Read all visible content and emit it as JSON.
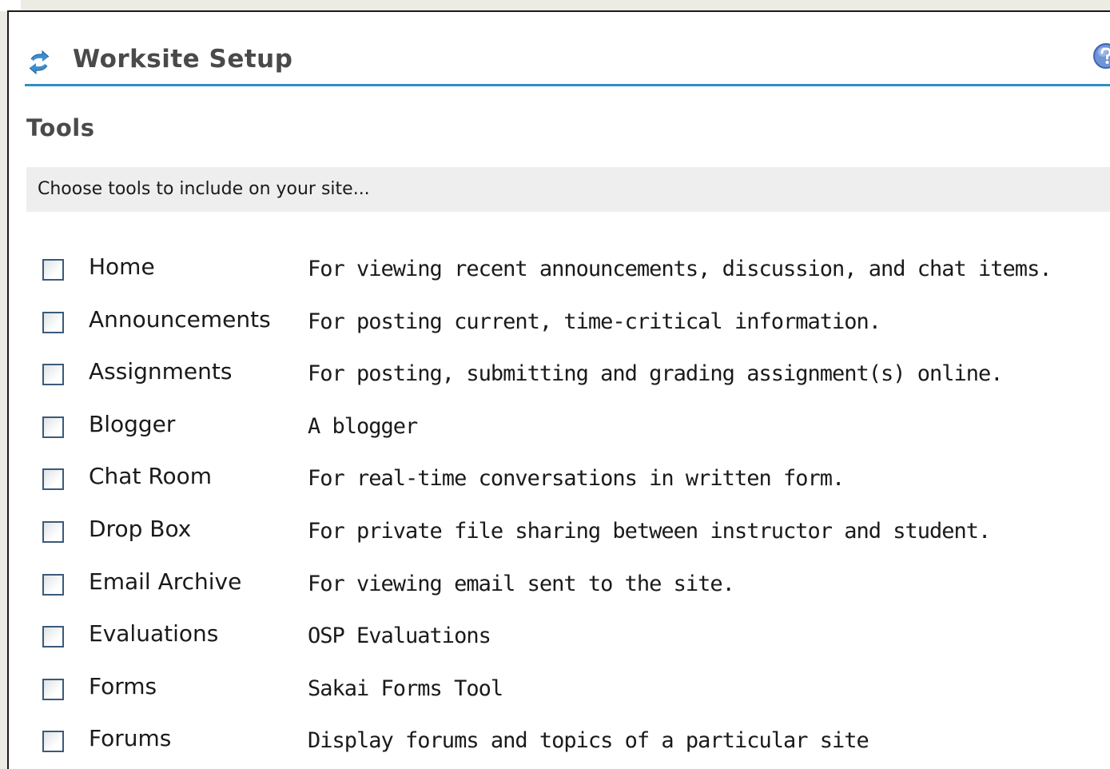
{
  "header": {
    "title": "Worksite Setup",
    "title_icon": "refresh-arrows-icon",
    "help_icon": "help-icon"
  },
  "section": {
    "title": "Tools",
    "instructions": "Choose tools to include on your site..."
  },
  "tools": [
    {
      "name": "Home",
      "description": "For viewing recent announcements, discussion, and chat items.",
      "checked": false
    },
    {
      "name": "Announcements",
      "description": "For posting current, time-critical information.",
      "checked": false
    },
    {
      "name": "Assignments",
      "description": "For posting, submitting and grading assignment(s) online.",
      "checked": false
    },
    {
      "name": "Blogger",
      "description": "A blogger",
      "checked": false
    },
    {
      "name": "Chat Room",
      "description": "For real-time conversations in written form.",
      "checked": false
    },
    {
      "name": "Drop Box",
      "description": "For private file sharing between instructor and student.",
      "checked": false
    },
    {
      "name": "Email Archive",
      "description": "For viewing email sent to the site.",
      "checked": false
    },
    {
      "name": "Evaluations",
      "description": "OSP Evaluations",
      "checked": false
    },
    {
      "name": "Forms",
      "description": "Sakai Forms Tool",
      "checked": false
    },
    {
      "name": "Forums",
      "description": "Display forums and topics of a particular site",
      "checked": false
    }
  ],
  "colors": {
    "accent_rule": "#2f8fc4",
    "heading_text": "#4a4a4a",
    "instruction_bg": "#eeeeee",
    "checkbox_border": "#3b5a7a"
  }
}
